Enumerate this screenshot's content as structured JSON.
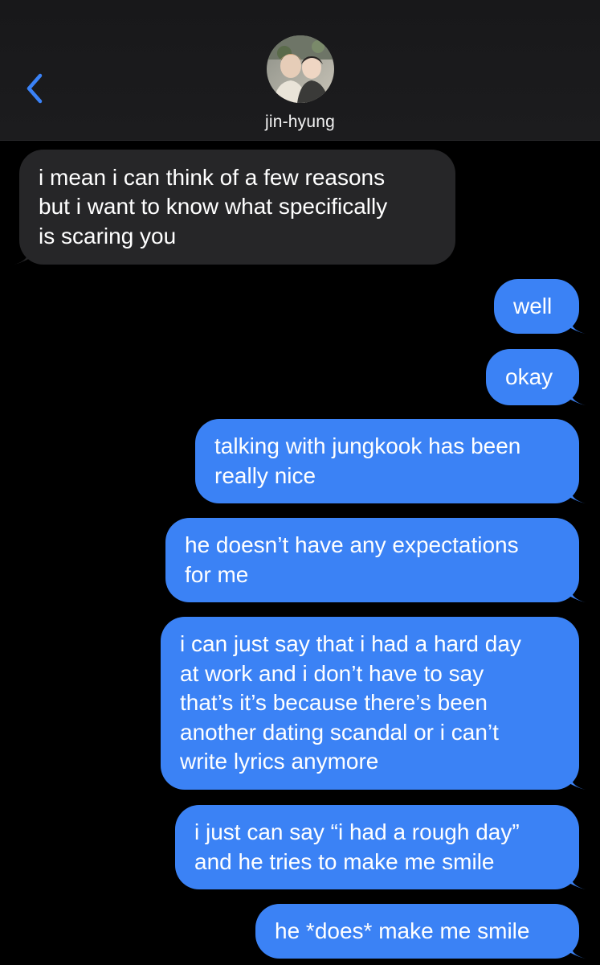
{
  "header": {
    "contact_name": "jin-hyung",
    "back_icon": "chevron-left-icon",
    "accent_color": "#3a82f7"
  },
  "messages": [
    {
      "direction": "incoming",
      "text": "i mean i can think of a few reasons\nbut i want to know what specifically\nis scaring you"
    },
    {
      "direction": "outgoing",
      "text": "well"
    },
    {
      "direction": "outgoing",
      "text": "okay"
    },
    {
      "direction": "outgoing",
      "text": "talking with jungkook has been\nreally nice"
    },
    {
      "direction": "outgoing",
      "text": "he doesn’t have any expectations\nfor me"
    },
    {
      "direction": "outgoing",
      "text": "i can just say that i had a hard day\nat work and i don’t have to say\nthat’s it’s because there’s been\nanother dating scandal or i can’t\nwrite lyrics anymore"
    },
    {
      "direction": "outgoing",
      "text": "i just can say “i had a rough day”\nand he tries to make me smile"
    },
    {
      "direction": "outgoing",
      "text": "he *does* make me smile"
    }
  ],
  "colors": {
    "outgoing_bubble": "#3b82f5",
    "incoming_bubble": "#262628",
    "background": "#000000"
  }
}
